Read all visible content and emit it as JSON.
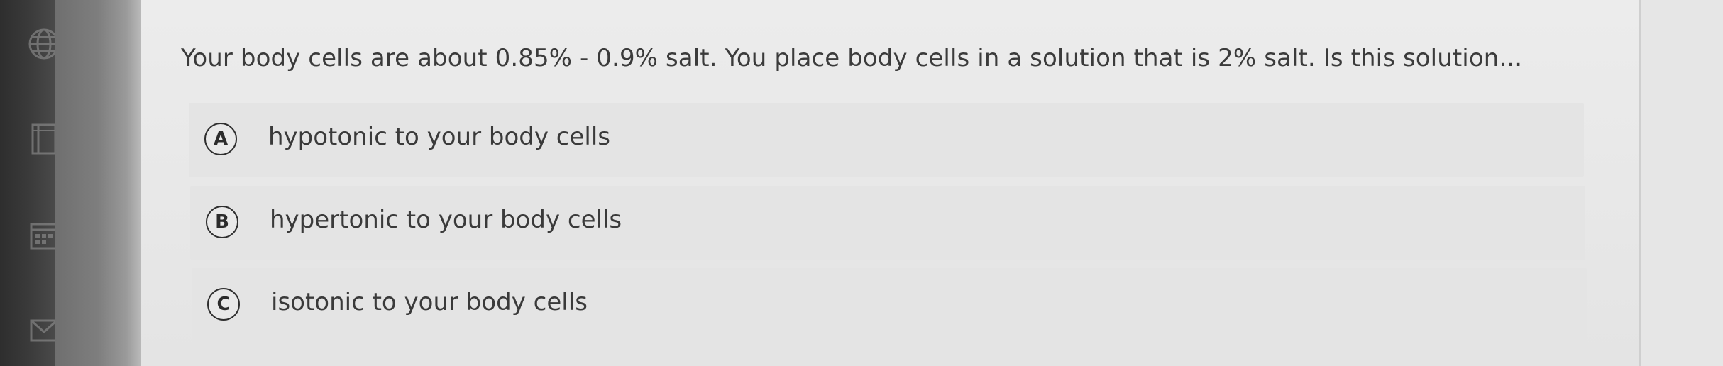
{
  "question": {
    "text": "Your body cells are about 0.85% - 0.9% salt. You place body cells in a solution that is 2% salt. Is this solution..."
  },
  "options": [
    {
      "letter": "A",
      "label": "hypotonic to your body cells"
    },
    {
      "letter": "B",
      "label": "hypertonic to your body cells"
    },
    {
      "letter": "C",
      "label": "isotonic to your body cells"
    }
  ],
  "sidebar": {
    "icons": [
      "globe-icon",
      "book-icon",
      "calendar-icon",
      "mail-icon"
    ]
  }
}
